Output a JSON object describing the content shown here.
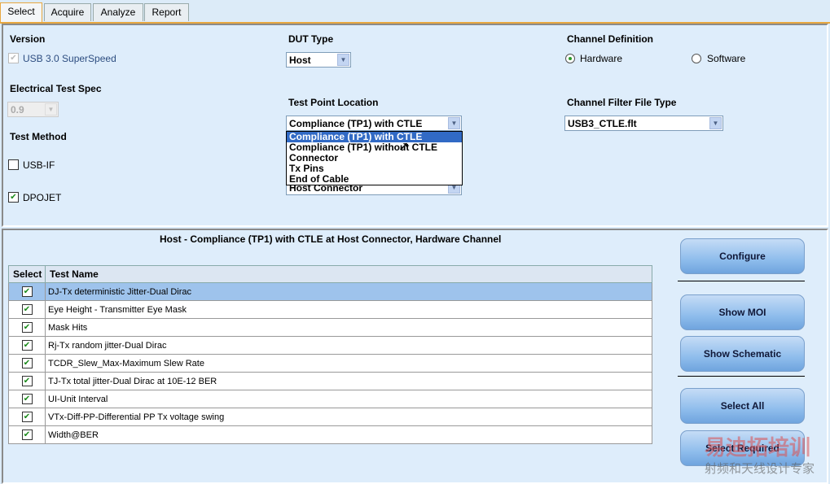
{
  "tabs": [
    "Select",
    "Acquire",
    "Analyze",
    "Report"
  ],
  "version": {
    "label": "Version",
    "option": "USB 3.0 SuperSpeed"
  },
  "spec": {
    "label": "Electrical Test Spec",
    "value": "0.9"
  },
  "method": {
    "label": "Test Method",
    "options": [
      "USB-IF",
      "DPOJET"
    ]
  },
  "dut": {
    "label": "DUT Type",
    "value": "Host"
  },
  "tpl": {
    "label": "Test Point Location",
    "value": "Compliance (TP1) with CTLE",
    "options": [
      "Compliance (TP1) with CTLE",
      "Compliance (TP1) without CTLE",
      "Connector",
      "Tx Pins",
      "End of Cable"
    ],
    "hidden_value": "Host Connector"
  },
  "channel": {
    "label": "Channel Definition",
    "options": [
      "Hardware",
      "Software"
    ]
  },
  "filter": {
    "label": "Channel Filter File Type",
    "value": "USB3_CTLE.flt"
  },
  "summary": "Host - Compliance (TP1) with CTLE at Host Connector, Hardware Channel",
  "table": {
    "headers": [
      "Select",
      "Test Name"
    ],
    "rows": [
      "DJ-Tx deterministic Jitter-Dual Dirac",
      "Eye Height - Transmitter Eye Mask",
      "Mask Hits",
      "Rj-Tx random jitter-Dual Dirac",
      "TCDR_Slew_Max-Maximum Slew Rate",
      "TJ-Tx total jitter-Dual Dirac at 10E-12 BER",
      "UI-Unit Interval",
      "VTx-Diff-PP-Differential PP Tx voltage swing",
      "Width@BER"
    ]
  },
  "buttons": [
    "Configure",
    "Show  MOI",
    "Show Schematic",
    "Select All",
    "Select Required"
  ],
  "watermark": [
    "易迪拓培训",
    "射频和天线设计专家"
  ]
}
